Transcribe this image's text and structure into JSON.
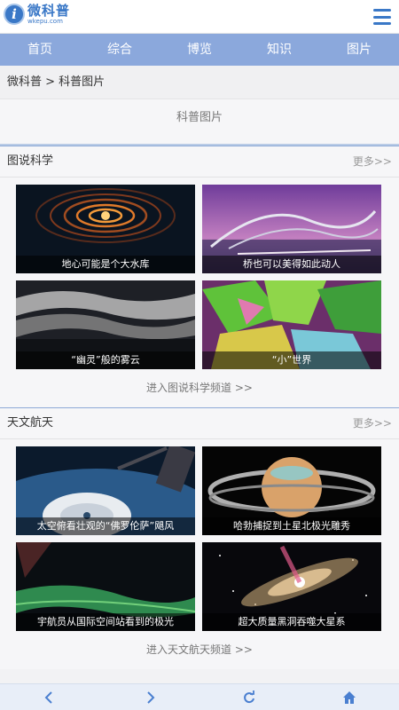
{
  "logo": {
    "name": "微科普",
    "domain": "wkepu.com"
  },
  "nav": [
    "首页",
    "综合",
    "博览",
    "知识",
    "图片"
  ],
  "breadcrumb": "微科普 > 科普图片",
  "page_title": "科普图片",
  "sections": [
    {
      "title": "图说科学",
      "more": "更多>>",
      "cards": [
        {
          "caption": "地心可能是个大水库"
        },
        {
          "caption": "桥也可以美得如此动人"
        },
        {
          "caption": "“幽灵”般的雾云"
        },
        {
          "caption": "“小”世界"
        }
      ],
      "channel": "进入图说科学频道 >>"
    },
    {
      "title": "天文航天",
      "more": "更多>>",
      "cards": [
        {
          "caption": "太空俯看壮观的“佛罗伦萨”飓风"
        },
        {
          "caption": "哈勃捕捉到土星北极光雕秀"
        },
        {
          "caption": "宇航员从国际空间站看到的极光"
        },
        {
          "caption": "超大质量黑洞吞噬大星系"
        }
      ],
      "channel": "进入天文航天频道 >>"
    }
  ],
  "bottom_icons": [
    "back-arrow-icon",
    "forward-arrow-icon",
    "refresh-icon",
    "home-icon"
  ],
  "colors": {
    "brand": "#3a78c7",
    "nav_bg": "#8ba8dc",
    "bottom_bar": "#e8eef8"
  }
}
